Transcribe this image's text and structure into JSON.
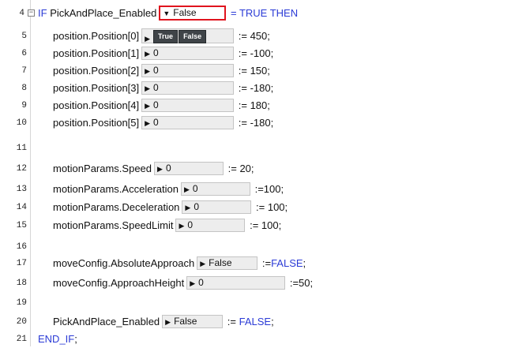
{
  "colors": {
    "keyword": "#2b3bd6",
    "highlight_border": "#e0141e",
    "value_box_bg": "#ededed",
    "button_bg": "#3f4448"
  },
  "lines": [
    {
      "num": "4",
      "kw1": "IF",
      "code": "PickAndPlace_Enabled",
      "value": "False",
      "value_prefix": "▼",
      "suffix": "= TRUE THEN"
    },
    {
      "num": "5",
      "code": "position.Position[0]",
      "btn_true": "True",
      "btn_false": "False",
      "suffix": ":= 450;"
    },
    {
      "num": "6",
      "code": "position.Position[1]",
      "value": "0",
      "value_prefix": "▶",
      "suffix": ":= -100;"
    },
    {
      "num": "7",
      "code": "position.Position[2]",
      "value": "0",
      "value_prefix": "▶",
      "suffix": ":= 150;"
    },
    {
      "num": "8",
      "code": "position.Position[3]",
      "value": "0",
      "value_prefix": "▶",
      "suffix": ":= -180;"
    },
    {
      "num": "9",
      "code": "position.Position[4]",
      "value": "0",
      "value_prefix": "▶",
      "suffix": ":= 180;"
    },
    {
      "num": "10",
      "code": "position.Position[5]",
      "value": "0",
      "value_prefix": "▶",
      "suffix": ":= -180;"
    },
    {
      "num": "11"
    },
    {
      "num": "12",
      "code": "motionParams.Speed",
      "value": "0",
      "value_prefix": "▶",
      "suffix": ":= 20;"
    },
    {
      "num": "13",
      "code": "motionParams.Acceleration",
      "value": "0",
      "value_prefix": "▶",
      "suffix": ":=100;"
    },
    {
      "num": "14",
      "code": "motionParams.Deceleration",
      "value": "0",
      "value_prefix": "▶",
      "suffix": ":= 100;"
    },
    {
      "num": "15",
      "code": "motionParams.SpeedLimit",
      "value": "0",
      "value_prefix": "▶",
      "suffix": ":= 100;"
    },
    {
      "num": "16"
    },
    {
      "num": "17",
      "code": "moveConfig.AbsoluteApproach",
      "value": "False",
      "value_prefix": "▶",
      "suffix_op": ":=",
      "suffix_kw": "FALSE",
      "suffix_end": ";"
    },
    {
      "num": "18",
      "code": "moveConfig.ApproachHeight",
      "value": "0",
      "value_prefix": "▶",
      "suffix": ":=50;"
    },
    {
      "num": "19"
    },
    {
      "num": "20",
      "code": "PickAndPlace_Enabled",
      "value": "False",
      "value_prefix": "▶",
      "suffix_op": ":=",
      "suffix_kw": "FALSE",
      "suffix_end": ";"
    },
    {
      "num": "21",
      "kw1": "END_IF",
      "kw1_end": ";"
    }
  ]
}
